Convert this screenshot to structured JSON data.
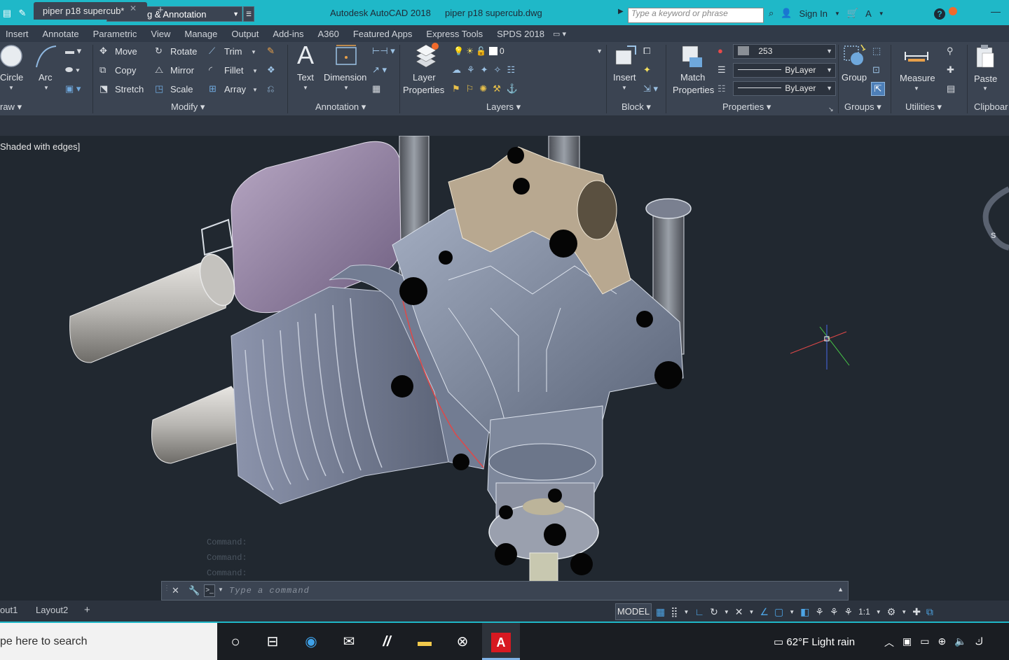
{
  "titlebar": {
    "workspace": "Drafting & Annotation",
    "app_title": "Autodesk AutoCAD 2018",
    "file_title": "piper p18 supercub.dwg",
    "search_placeholder": "Type a keyword or phrase",
    "sign_in": "Sign In"
  },
  "ribbon_tabs": [
    "Insert",
    "Annotate",
    "Parametric",
    "View",
    "Manage",
    "Output",
    "Add-ins",
    "A360",
    "Featured Apps",
    "Express Tools",
    "SPDS 2018"
  ],
  "ribbon": {
    "draw": {
      "circle": "Circle",
      "arc": "Arc",
      "panel": "raw"
    },
    "modify": {
      "move": "Move",
      "rotate": "Rotate",
      "trim": "Trim",
      "copy": "Copy",
      "mirror": "Mirror",
      "fillet": "Fillet",
      "stretch": "Stretch",
      "scale": "Scale",
      "array": "Array",
      "panel": "Modify"
    },
    "annotation": {
      "text": "Text",
      "dimension": "Dimension",
      "panel": "Annotation"
    },
    "layers": {
      "layer_properties_1": "Layer",
      "layer_properties_2": "Properties",
      "current_layer": "0",
      "panel": "Layers"
    },
    "block": {
      "insert": "Insert",
      "panel": "Block"
    },
    "properties": {
      "match_1": "Match",
      "match_2": "Properties",
      "color": "253",
      "linetype": "ByLayer",
      "lineweight": "ByLayer",
      "panel": "Properties"
    },
    "groups": {
      "group": "Group",
      "panel": "Groups"
    },
    "utilities": {
      "measure": "Measure",
      "panel": "Utilities"
    },
    "clipboard": {
      "paste": "Paste",
      "panel": "Clipboar"
    }
  },
  "file_tab": {
    "name": "piper p18 supercub*"
  },
  "viewport": {
    "visual_style": "Shaded with edges]"
  },
  "command": {
    "placeholder": "Type a command",
    "history": [
      "Command:",
      "Command:",
      "Command:"
    ]
  },
  "layout_tabs": [
    "out1",
    "Layout2"
  ],
  "status": {
    "model": "MODEL",
    "scale": "1:1"
  },
  "taskbar": {
    "search": "pe here to search",
    "weather": "62°F  Light rain"
  },
  "colors": {
    "titlebar": "#1fb8c8",
    "ribbon": "#3b4452",
    "viewport": "#212830",
    "engine_body": "#7e8aa0",
    "tank": "#9a8aa6"
  }
}
